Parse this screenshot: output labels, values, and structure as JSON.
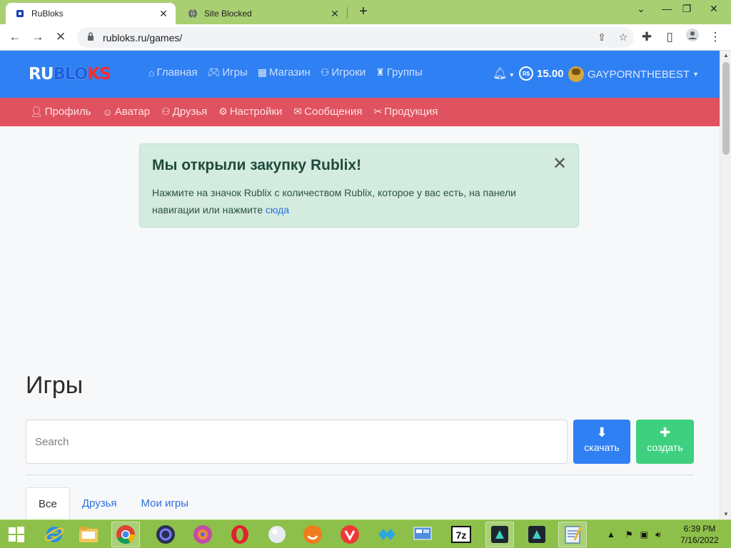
{
  "browser": {
    "tabs": [
      {
        "title": "RuBloks",
        "active": true
      },
      {
        "title": "Site Blocked",
        "active": false
      }
    ],
    "new_tab": "+",
    "url": "rubloks.ru/games/"
  },
  "site": {
    "logo": {
      "part1": "RU",
      "part2": "BLO",
      "part3": "KS"
    },
    "nav": [
      {
        "label": "Главная",
        "icon": "home-icon"
      },
      {
        "label": "Игры",
        "icon": "gamepad-icon"
      },
      {
        "label": "Магазин",
        "icon": "shop-icon"
      },
      {
        "label": "Игроки",
        "icon": "users-icon"
      },
      {
        "label": "Группы",
        "icon": "chess-icon"
      }
    ],
    "balance": "15.00",
    "currency_symbol": "R$",
    "username": "GAYPORNTHEBEST",
    "subnav": [
      {
        "label": "Профиль",
        "icon": "person-icon"
      },
      {
        "label": "Аватар",
        "icon": "avatar-icon"
      },
      {
        "label": "Друзья",
        "icon": "friends-icon"
      },
      {
        "label": "Настройки",
        "icon": "gear-icon"
      },
      {
        "label": "Сообщения",
        "icon": "envelope-icon"
      },
      {
        "label": "Продукция",
        "icon": "tools-icon"
      }
    ]
  },
  "alert": {
    "title": "Мы открыли закупку Rublix!",
    "text": "Нажмите на значок Rublix с количеством Rublix, которое у вас есть, на панели навигации или нажмите",
    "link": "сюда"
  },
  "games": {
    "heading": "Игры",
    "search_placeholder": "Search",
    "download_label": "скачать",
    "create_label": "создать",
    "tabs": [
      "Все",
      "Друзья",
      "Мои игры"
    ]
  },
  "taskbar": {
    "time": "6:39 PM",
    "date": "7/16/2022"
  },
  "colors": {
    "topnav": "#2f80f2",
    "subnav": "#e0525f",
    "alert_bg": "#d4ebe0",
    "create_btn": "#3ed07f",
    "tabstrip": "#a9cf73"
  }
}
